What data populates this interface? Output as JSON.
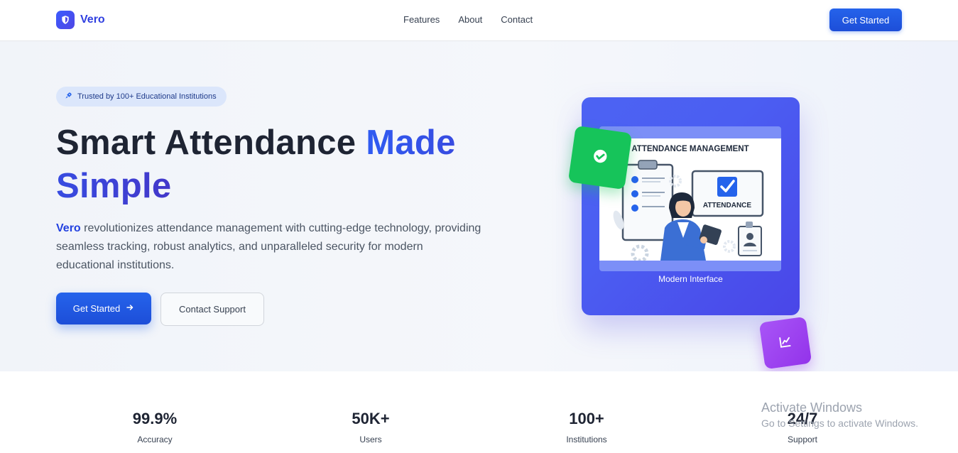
{
  "nav": {
    "brand": "Vero",
    "links": [
      "Features",
      "About",
      "Contact"
    ],
    "cta": "Get Started"
  },
  "hero": {
    "badge": "Trusted by 100+ Educational Institutions",
    "headline_part1": "Smart Attendance ",
    "headline_highlight": "Made Simple",
    "description_brand": "Vero",
    "description_rest": " revolutionizes attendance management with cutting-edge technology, providing seamless tracking, robust analytics, and unparalleled security for modern educational institutions.",
    "primary_button": "Get Started",
    "secondary_button": "Contact Support"
  },
  "visual": {
    "image_title": "ATTENDANCE MANAGEMENT",
    "image_label": "ATTENDANCE",
    "caption": "Modern Interface"
  },
  "stats": [
    {
      "value": "99.9%",
      "label": "Accuracy"
    },
    {
      "value": "50K+",
      "label": "Users"
    },
    {
      "value": "100+",
      "label": "Institutions"
    },
    {
      "value": "24/7",
      "label": "Support"
    }
  ],
  "watermark": {
    "title": "Activate Windows",
    "subtitle": "Go to Settings to activate Windows."
  },
  "colors": {
    "primary": "#1d4ed8",
    "brand": "#2f3fe0",
    "success": "#16c45a",
    "accent_purple": "#9333ea"
  },
  "icons": {
    "brand": "shield-icon",
    "badge": "rocket-icon",
    "primary_button": "arrow-right-icon",
    "green_tile": "check-circle-icon",
    "purple_tile": "chart-line-icon"
  }
}
